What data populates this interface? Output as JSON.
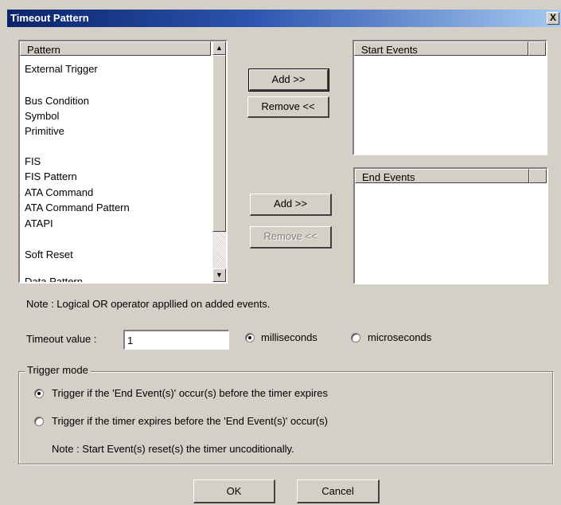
{
  "window": {
    "title": "Timeout Pattern",
    "close_label": "X"
  },
  "pattern_list": {
    "header": "Pattern",
    "items": [
      "External Trigger",
      "Bus Condition",
      "Symbol",
      "Primitive",
      "FIS",
      "FIS Pattern",
      "ATA Command",
      "ATA Command Pattern",
      "ATAPI",
      "Soft Reset",
      "Data Pattern"
    ]
  },
  "start_events": {
    "header": "Start Events",
    "add_label": "Add >>",
    "remove_label": "Remove <<"
  },
  "end_events": {
    "header": "End Events",
    "add_label": "Add >>",
    "remove_label": "Remove <<"
  },
  "note_or": "Note : Logical OR operator appllied on added events.",
  "timeout": {
    "label": "Timeout value :",
    "value": "1",
    "unit_ms": "milliseconds",
    "unit_us": "microseconds",
    "selected_unit": "milliseconds"
  },
  "trigger_mode": {
    "label": "Trigger mode",
    "option1": "Trigger if the 'End Event(s)' occur(s) before the timer expires",
    "option2": "Trigger if the timer expires before the 'End Event(s)' occur(s)",
    "selected": "option1",
    "note": "Note : Start Event(s) reset(s) the timer uncoditionally."
  },
  "footer": {
    "ok_label": "OK",
    "cancel_label": "Cancel"
  },
  "icons": {
    "scroll_up": "scroll-up-arrow",
    "scroll_down": "scroll-down-arrow"
  }
}
